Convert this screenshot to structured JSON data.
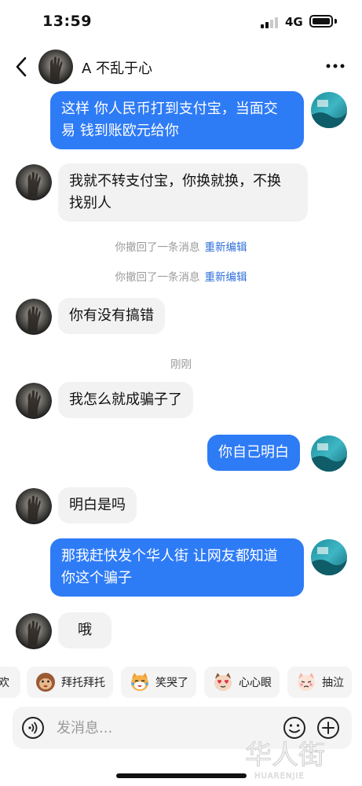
{
  "status_bar": {
    "time": "13:59",
    "network": "4G"
  },
  "header": {
    "contact_name": "A 不乱于心"
  },
  "messages": [
    {
      "from": "me",
      "text": "这样 你人民币打到支付宝，当面交\n易 钱到账欧元给你"
    },
    {
      "from": "them",
      "text": "我就不转支付宝，你换就换，不换\n找别人"
    },
    {
      "from": "them",
      "text": "你有没有搞错"
    },
    {
      "from": "them",
      "text": "我怎么就成骗子了"
    },
    {
      "from": "me",
      "text": "你自己明白"
    },
    {
      "from": "them",
      "text": "明白是吗"
    },
    {
      "from": "me",
      "text": "那我赶快发个华人街 让网友都知道\n你这个骗子"
    },
    {
      "from": "them",
      "text": "哦"
    }
  ],
  "system": {
    "recall_1": "你撤回了一条消息",
    "recall_2": "你撤回了一条消息",
    "reedit": "重新编辑",
    "timestamp": "刚刚"
  },
  "quick_replies": [
    "欢",
    "拜托拜托",
    "笑哭了",
    "心心眼",
    "抽泣"
  ],
  "input": {
    "placeholder": "发消息..."
  },
  "watermark": {
    "text": "华人街",
    "sub": "HUARENJIE"
  },
  "colors": {
    "accent": "#2e7bf6",
    "bubble_them": "#f2f2f2",
    "link": "#2e6fd8"
  },
  "icons": [
    "back-icon",
    "more-icon",
    "voice-icon",
    "emoji-icon",
    "plus-icon"
  ]
}
